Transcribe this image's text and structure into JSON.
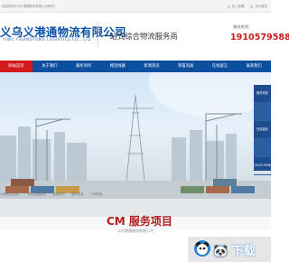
{
  "topbar": {
    "welcome": "欢迎来到义乌义港通物流有限公司网站！",
    "links": [
      "加入收藏",
      "设为首页"
    ]
  },
  "header": {
    "logo_cn": "义乌义港通物流有限公司",
    "logo_en": "YIWU YIGANGTONG LOGISTICS CO., LTD",
    "slogan": "一站式综合物流服务商",
    "hotline_label": "服务热线：",
    "hotline_number": "1910579588"
  },
  "nav": {
    "items": [
      "网站首页",
      "关于我们",
      "服务项目",
      "物流线路",
      "新闻资讯",
      "荣誉资质",
      "在线留言",
      "联系我们"
    ]
  },
  "rightbar": {
    "items": [
      "服务热线",
      "",
      "在线留言",
      "",
      "1910579588"
    ]
  },
  "breadcrumb": {
    "items": [
      "大家都在搜索：",
      "物流运输服务",
      "搬家物流",
      "国际物流",
      "广州物流"
    ]
  },
  "intro": {
    "title": "CM 服务项目",
    "subtitle": "义乌港通物流有限公司"
  },
  "watermark": {
    "text": "🐼 下载"
  },
  "colors": {
    "nav_bg": "#0c4f9f",
    "nav_active": "#d3191b",
    "logo": "#0d52a8",
    "hotline": "#cc1b1b"
  }
}
